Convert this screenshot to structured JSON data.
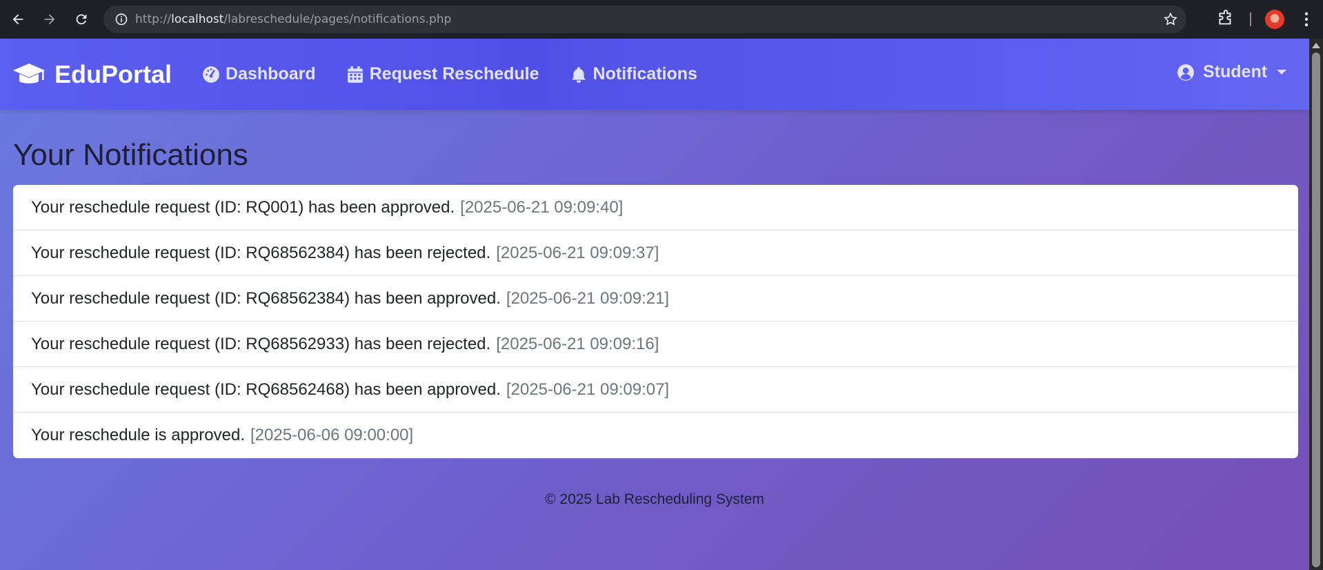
{
  "browser": {
    "url_prefix": "http://",
    "url_host": "localhost",
    "url_path": "/labreschedule/pages/notifications.php"
  },
  "navbar": {
    "brand": "EduPortal",
    "links": [
      {
        "label": "Dashboard",
        "icon": "gauge-icon"
      },
      {
        "label": "Request Reschedule",
        "icon": "calendar-icon"
      },
      {
        "label": "Notifications",
        "icon": "bell-icon"
      }
    ],
    "user": "Student"
  },
  "main": {
    "title": "Your Notifications",
    "notifications": [
      {
        "message": "Your reschedule request (ID: RQ001) has been approved.",
        "timestamp": "[2025-06-21 09:09:40]"
      },
      {
        "message": "Your reschedule request (ID: RQ68562384) has been rejected.",
        "timestamp": "[2025-06-21 09:09:37]"
      },
      {
        "message": "Your reschedule request (ID: RQ68562384) has been approved.",
        "timestamp": "[2025-06-21 09:09:21]"
      },
      {
        "message": "Your reschedule request (ID: RQ68562933) has been rejected.",
        "timestamp": "[2025-06-21 09:09:16]"
      },
      {
        "message": "Your reschedule request (ID: RQ68562468) has been approved.",
        "timestamp": "[2025-06-21 09:09:07]"
      },
      {
        "message": "Your reschedule is approved.",
        "timestamp": "[2025-06-06 09:00:00]"
      }
    ]
  },
  "footer": {
    "text": "© 2025 Lab Rescheduling System"
  },
  "colors": {
    "navbar": "#5b5ff0",
    "page_gradient_start": "#6a7be0",
    "page_gradient_end": "#7550b5",
    "timestamp": "#6c757d"
  }
}
